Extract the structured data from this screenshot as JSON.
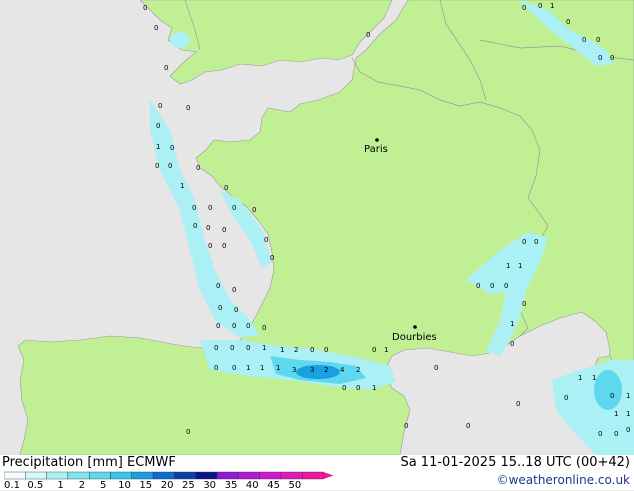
{
  "header": {
    "title": "Precipitation [mm]  ECMWF",
    "valid": "Sa 11-01-2025 15..18 UTC (00+42)",
    "credit": "©weatheronline.co.uk"
  },
  "places": [
    {
      "name": "Paris",
      "label": "Paris"
    },
    {
      "name": "Dourbies",
      "label": "Dourbies"
    }
  ],
  "colors": {
    "sea": "#e6e6e6",
    "land": "#c1ef94",
    "border": "#9a9a9a",
    "precip_light": "#aaf0f5",
    "precip_mid": "#5ed8ee",
    "precip_heavy": "#1a9fe0"
  },
  "legend": {
    "ticks": [
      "0.1",
      "0.5",
      "1",
      "2",
      "5",
      "10",
      "15",
      "20",
      "25",
      "30",
      "35",
      "40",
      "45",
      "50"
    ],
    "colors": [
      "#f4fdfd",
      "#d2fafa",
      "#aaf0f5",
      "#7fe4f0",
      "#5ed8ee",
      "#3ac6ec",
      "#1a9fe0",
      "#0b6ccf",
      "#0a3ea8",
      "#0a1486",
      "#8c1ad8",
      "#b019d6",
      "#d218cc",
      "#e018b8",
      "#f01898"
    ]
  },
  "precip_values": [
    "0",
    "1",
    "0",
    "1",
    "2",
    "3",
    "4"
  ]
}
